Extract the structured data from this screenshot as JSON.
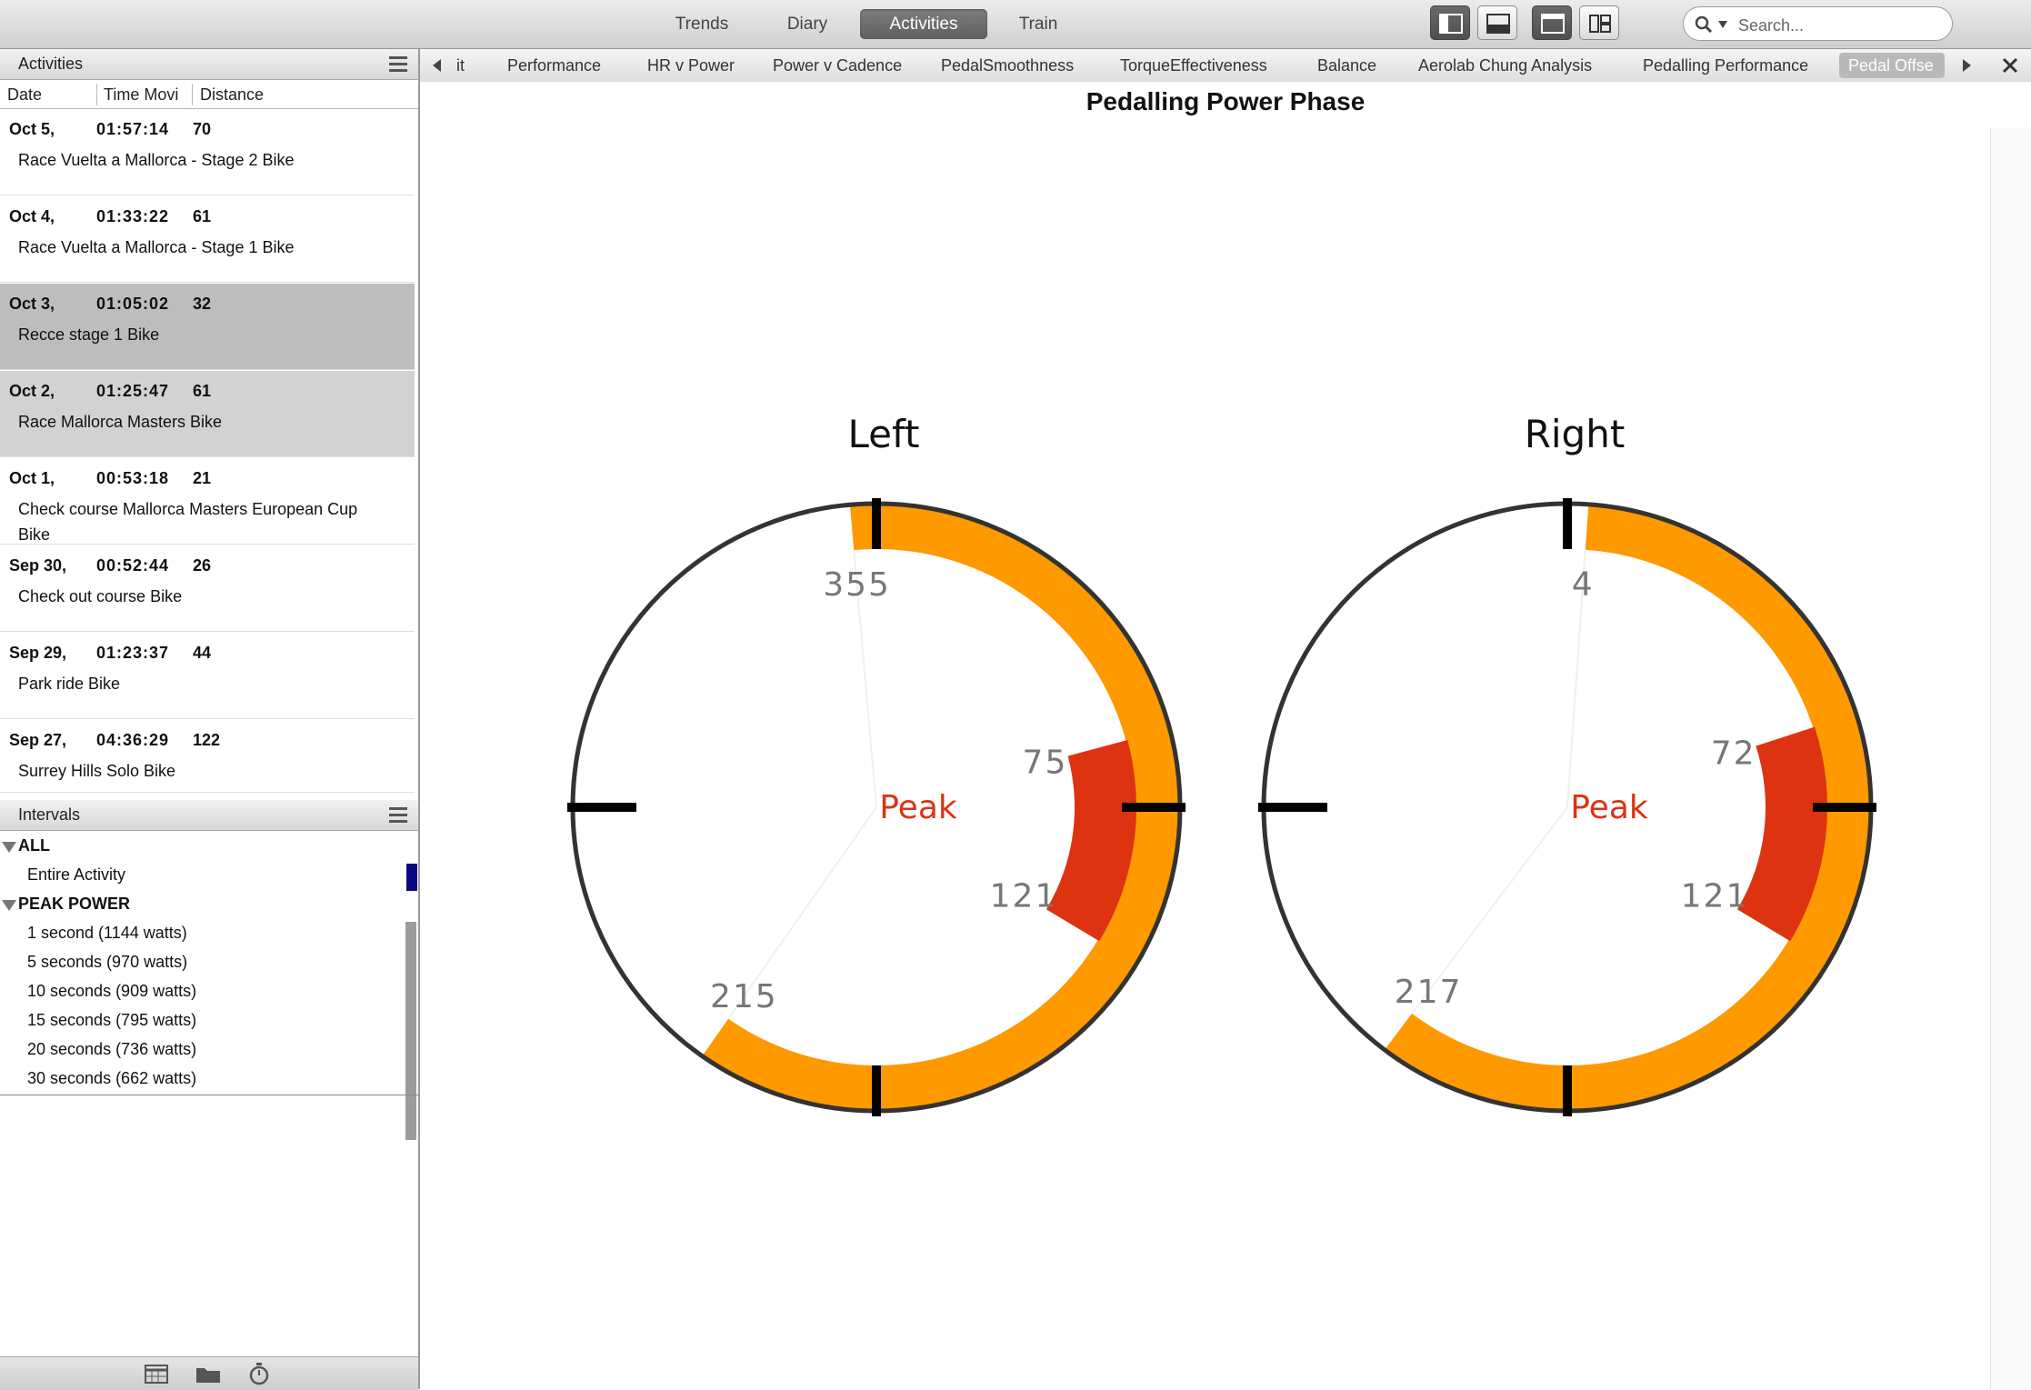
{
  "toolbar": {
    "tabs": [
      {
        "label": "Trends",
        "active": false
      },
      {
        "label": "Diary",
        "active": false
      },
      {
        "label": "Activities",
        "active": true
      },
      {
        "label": "Train",
        "active": false
      }
    ],
    "search_placeholder": "Search..."
  },
  "activities_panel": {
    "title": "Activities",
    "columns": [
      "Date",
      "Time Movi",
      "Distance"
    ],
    "rows": [
      {
        "date": "Oct 5,",
        "time": "01:57:14",
        "distance": "70",
        "name": "Race Vuelta a Mallorca - Stage 2 Bike"
      },
      {
        "date": "Oct 4,",
        "time": "01:33:22",
        "distance": "61",
        "name": "Race Vuelta a Mallorca - Stage 1 Bike"
      },
      {
        "date": "Oct 3,",
        "time": "01:05:02",
        "distance": "32",
        "name": "Recce stage 1 Bike"
      },
      {
        "date": "Oct 2,",
        "time": "01:25:47",
        "distance": "61",
        "name": "Race Mallorca Masters Bike"
      },
      {
        "date": "Oct 1,",
        "time": "00:53:18",
        "distance": "21",
        "name": "Check course Mallorca Masters European Cup Bike"
      },
      {
        "date": "Sep 30,",
        "time": "00:52:44",
        "distance": "26",
        "name": "Check out course Bike"
      },
      {
        "date": "Sep 29,",
        "time": "01:23:37",
        "distance": "44",
        "name": "Park ride Bike"
      },
      {
        "date": "Sep 27,",
        "time": "04:36:29",
        "distance": "122",
        "name": "Surrey Hills Solo Bike"
      }
    ]
  },
  "intervals_panel": {
    "title": "Intervals",
    "groups": [
      {
        "label": "ALL",
        "items": [
          "Entire Activity"
        ]
      },
      {
        "label": "PEAK POWER",
        "items": [
          "1 second (1144 watts)",
          "5 seconds (970 watts)",
          "10 seconds (909 watts)",
          "15 seconds (795 watts)",
          "20 seconds (736 watts)",
          "30 seconds (662 watts)"
        ]
      }
    ]
  },
  "chart_tabs": [
    "it",
    "Performance",
    "HR v Power",
    "Power v Cadence",
    "PedalSmoothness",
    "TorqueEffectiveness",
    "Balance",
    "Aerolab Chung Analysis",
    "Pedalling Performance",
    "Pedal Offse"
  ],
  "chart": {
    "title": "Pedalling Power Phase",
    "peak_label": "Peak",
    "colors": {
      "phase": "#ff9900",
      "peak": "#dd3311",
      "ring": "#333333",
      "peak_text": "#dd3311",
      "angle_text": "#777777"
    },
    "dials": [
      {
        "label": "Left",
        "start": "355",
        "end": "215",
        "peak_start": "75",
        "peak_end": "121"
      },
      {
        "label": "Right",
        "start": "4",
        "end": "217",
        "peak_start": "72",
        "peak_end": "121"
      }
    ]
  }
}
